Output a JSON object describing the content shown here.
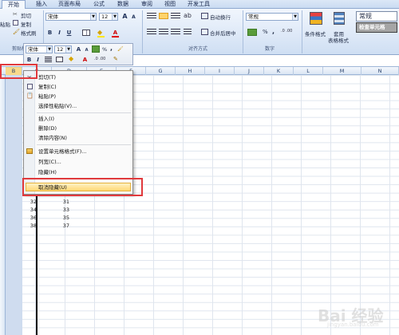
{
  "tabs": [
    "开始",
    "插入",
    "页面布局",
    "公式",
    "数据",
    "审阅",
    "视图",
    "开发工具"
  ],
  "clipboard": {
    "cut": "剪切",
    "copy": "复制",
    "format_painter": "格式刷",
    "paste_partial": "粘贴",
    "label": "剪贴板"
  },
  "font": {
    "name": "宋体",
    "size": "12",
    "grow": "A",
    "shrink": "A",
    "bold": "B",
    "italic": "I",
    "underline": "U",
    "color_letter": "A"
  },
  "alignment": {
    "wrap": "自动换行",
    "merge": "合并后居中",
    "label": "对齐方式"
  },
  "number": {
    "format": "常规",
    "percent": "%",
    "comma": ",",
    "label": "数字"
  },
  "styles": {
    "conditional": "条件格式",
    "table": "套用\n表格格式",
    "table_line1": "套用",
    "table_line2": "表格格式",
    "style_normal": "常规",
    "style_check": "检查单元格"
  },
  "mini_toolbar": {
    "font": "宋体",
    "size": "12",
    "grow": "A",
    "shrink": "A",
    "bold": "B",
    "italic": "I",
    "color_letter": "A",
    "percent": "%",
    "comma": ","
  },
  "columns": [
    "B",
    "C",
    "D",
    "E",
    "F",
    "G",
    "H",
    "I",
    "J",
    "K",
    "L",
    "M",
    "N"
  ],
  "cells": [
    {
      "b": "32",
      "c": "31"
    },
    {
      "b": "34",
      "c": "33"
    },
    {
      "b": "36",
      "c": "35"
    },
    {
      "b": "38",
      "c": "37"
    }
  ],
  "hidden_cell_partial": "32",
  "context_menu": {
    "items": [
      "剪切(T)",
      "复制(C)",
      "粘贴(P)",
      "选择性粘贴(V)...",
      "插入(I)",
      "删除(D)",
      "清除内容(N)",
      "设置单元格格式(F)...",
      "列宽(C)...",
      "隐藏(H)",
      "取消隐藏(U)"
    ],
    "highlighted": "取消隐藏(U)"
  },
  "watermark": {
    "main": "Bai 经验",
    "sub": "jingyan.baidu.com"
  },
  "colors": {
    "highlight_border": "#e0393c",
    "menu_highlight": "#ffd873",
    "ribbon": "#dde8f7"
  }
}
